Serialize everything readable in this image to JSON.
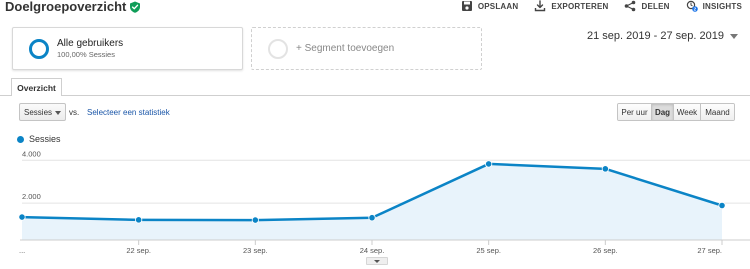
{
  "header": {
    "title": "Doelgroepoverzicht",
    "actions": [
      {
        "label": "OPSLAAN",
        "icon": "save-icon"
      },
      {
        "label": "EXPORTEREN",
        "icon": "export-icon"
      },
      {
        "label": "DELEN",
        "icon": "share-icon"
      },
      {
        "label": "INSIGHTS",
        "icon": "insights-icon",
        "badge": "2"
      }
    ]
  },
  "segments": {
    "primary": {
      "name": "Alle gebruikers",
      "detail": "100,00% Sessies"
    },
    "add_label": "+ Segment toevoegen"
  },
  "date_range": "21 sep. 2019 - 27 sep. 2019",
  "tabs": {
    "overview": "Overzicht"
  },
  "controls": {
    "metric": "Sessies",
    "vs_label": "vs.",
    "select_metric": "Selecteer een statistiek",
    "granularity": [
      "Per uur",
      "Dag",
      "Week",
      "Maand"
    ],
    "granularity_selected": "Dag"
  },
  "colors": {
    "accent": "#0b84c6",
    "fill": "#e8f3fb",
    "link": "#1a56a8"
  },
  "chart_data": {
    "type": "area",
    "x": [
      "...",
      "22 sep.",
      "23 sep.",
      "24 sep.",
      "25 sep.",
      "26 sep.",
      "27 sep."
    ],
    "series": [
      {
        "name": "Sessies",
        "values": [
          1070,
          940,
          930,
          1040,
          3550,
          3320,
          1610
        ]
      }
    ],
    "yticks": [
      "4.000",
      "2.000"
    ],
    "ylim": [
      0,
      4200
    ],
    "grid": true
  }
}
